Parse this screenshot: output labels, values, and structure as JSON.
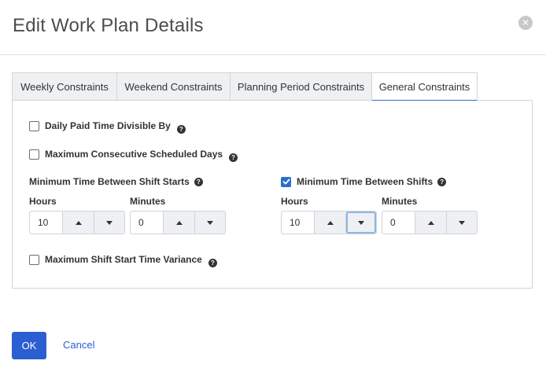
{
  "dialog": {
    "title": "Edit Work Plan Details",
    "close_glyph": "✕"
  },
  "tabs": [
    {
      "label": "Weekly Constraints",
      "active": false
    },
    {
      "label": "Weekend Constraints",
      "active": false
    },
    {
      "label": "Planning Period Constraints",
      "active": false
    },
    {
      "label": "General Constraints",
      "active": true
    }
  ],
  "general": {
    "daily_paid": {
      "label": "Daily Paid Time Divisible By",
      "checked": false
    },
    "max_consecutive": {
      "label": "Maximum Consecutive Scheduled Days",
      "checked": false
    },
    "min_between_starts": {
      "label": "Minimum Time Between Shift Starts",
      "hours_label": "Hours",
      "hours_value": "10",
      "minutes_label": "Minutes",
      "minutes_value": "0"
    },
    "min_between_shifts": {
      "label": "Minimum Time Between Shifts",
      "checked": true,
      "hours_label": "Hours",
      "hours_value": "10",
      "minutes_label": "Minutes",
      "minutes_value": "0"
    },
    "max_start_variance": {
      "label": "Maximum Shift Start Time Variance",
      "checked": false
    }
  },
  "footer": {
    "ok_label": "OK",
    "cancel_label": "Cancel"
  },
  "icons": {
    "help": "question-circle-icon",
    "close": "close-circle-icon",
    "increment": "caret-up-icon",
    "decrement": "caret-down-icon"
  },
  "colors": {
    "primary": "#2b5fd1",
    "tab_active_underline": "#2b6fc7",
    "checkbox_checked": "#2b6fc7"
  }
}
